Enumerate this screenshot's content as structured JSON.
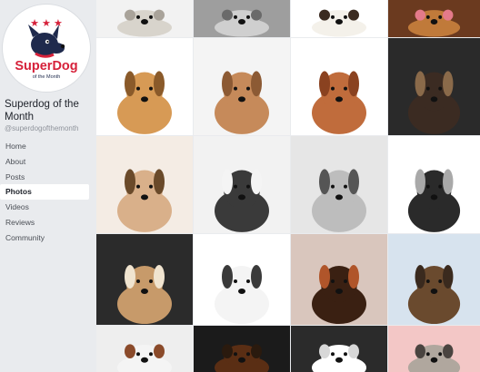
{
  "page": {
    "name": "Superdog of the Month",
    "handle": "@superdogofthemonth"
  },
  "logo": {
    "brand": "SuperDog",
    "tagline": "of the Month",
    "stars": "★ ★ ★",
    "colors": {
      "red": "#d6213a",
      "navy": "#1f2a4d",
      "star": "#d6213a"
    }
  },
  "nav": {
    "items": [
      {
        "label": "Home",
        "active": false
      },
      {
        "label": "About",
        "active": false
      },
      {
        "label": "Posts",
        "active": false
      },
      {
        "label": "Photos",
        "active": true
      },
      {
        "label": "Videos",
        "active": false
      },
      {
        "label": "Reviews",
        "active": false
      },
      {
        "label": "Community",
        "active": false
      }
    ]
  },
  "photos": [
    {
      "subject": "white dog lying",
      "bg": "#f2f2f2",
      "dog": "#d8d4cc",
      "accent": "#a9a39a"
    },
    {
      "subject": "grey terrier",
      "bg": "#9e9e9e",
      "dog": "#cfcfcf",
      "accent": "#6a6a6a"
    },
    {
      "subject": "jack russell",
      "bg": "#ffffff",
      "dog": "#f4f1ea",
      "accent": "#3a2a20"
    },
    {
      "subject": "golden retriever",
      "bg": "#6b3a1f",
      "dog": "#c07a3a",
      "accent": "#e47a8a"
    },
    {
      "subject": "labrador puppy",
      "bg": "#ffffff",
      "dog": "#d79a55",
      "accent": "#8a5a2a"
    },
    {
      "subject": "poodle puppy",
      "bg": "#f4f4f4",
      "dog": "#c68a5a",
      "accent": "#8c5a34"
    },
    {
      "subject": "shar pei",
      "bg": "#ffffff",
      "dog": "#c06c3c",
      "accent": "#8a4220"
    },
    {
      "subject": "black tan mix",
      "bg": "#2a2a2a",
      "dog": "#3b2b22",
      "accent": "#8a6a4a"
    },
    {
      "subject": "saluki",
      "bg": "#f4ece4",
      "dog": "#d9b08a",
      "accent": "#6a4a2a"
    },
    {
      "subject": "shih tzu",
      "bg": "#f2f2f2",
      "dog": "#3a3a3a",
      "accent": "#f4f4f4"
    },
    {
      "subject": "chihuahua bw",
      "bg": "#e6e6e6",
      "dog": "#bdbdbd",
      "accent": "#555555"
    },
    {
      "subject": "schnauzer puppy",
      "bg": "#ffffff",
      "dog": "#2a2a2a",
      "accent": "#a9a9a9"
    },
    {
      "subject": "czech wolfdog",
      "bg": "#2b2b2b",
      "dog": "#c79a6a",
      "accent": "#f0e4d0"
    },
    {
      "subject": "jack russell puppy",
      "bg": "#ffffff",
      "dog": "#f4f4f4",
      "accent": "#3a3a3a"
    },
    {
      "subject": "pinscher",
      "bg": "#d9c6bd",
      "dog": "#3a2012",
      "accent": "#b0552a"
    },
    {
      "subject": "yorkies",
      "bg": "#d7e3ee",
      "dog": "#6a4a2e",
      "accent": "#3a2a1e"
    },
    {
      "subject": "jack russell run",
      "bg": "#eeeeee",
      "dog": "#f4f4f4",
      "accent": "#8a4a2a"
    },
    {
      "subject": "dachshund",
      "bg": "#1b1b1b",
      "dog": "#5a2e14",
      "accent": "#2a1a0e"
    },
    {
      "subject": "westie",
      "bg": "#2b2b2b",
      "dog": "#ffffff",
      "accent": "#d8d8d8"
    },
    {
      "subject": "schnauzer pink",
      "bg": "#f3c7c6",
      "dog": "#b0a79e",
      "accent": "#4a4440"
    }
  ]
}
